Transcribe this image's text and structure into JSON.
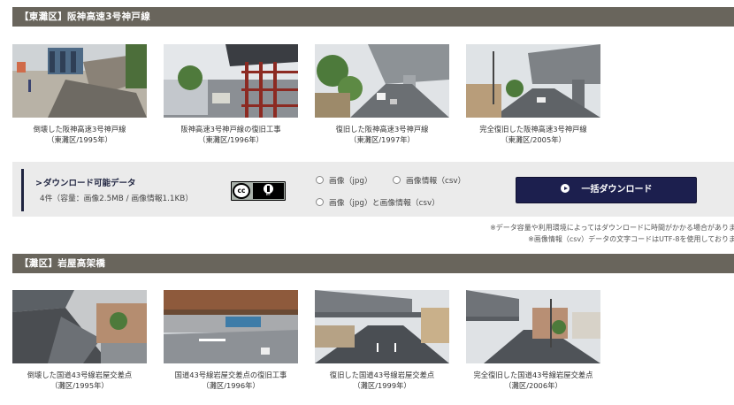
{
  "sections": [
    {
      "title": "【東灘区】阪神高速3号神戸線",
      "photos": [
        {
          "caption": "倒壊した阪神高速3号神戸線",
          "sub": "（東灘区/1995年）"
        },
        {
          "caption": "阪神高速3号神戸線の復旧工事",
          "sub": "（東灘区/1996年）"
        },
        {
          "caption": "復旧した阪神高速3号神戸線",
          "sub": "（東灘区/1997年）"
        },
        {
          "caption": "完全復旧した阪神高速3号神戸線",
          "sub": "（東灘区/2005年）"
        }
      ]
    },
    {
      "title": "【灘区】岩屋高架橋",
      "photos": [
        {
          "caption": "倒壊した国道43号線岩屋交差点",
          "sub": "（灘区/1995年）"
        },
        {
          "caption": "国道43号線岩屋交差点の復旧工事",
          "sub": "（灘区/1996年）"
        },
        {
          "caption": "復旧した国道43号線岩屋交差点",
          "sub": "（灘区/1999年）"
        },
        {
          "caption": "完全復旧した国道43号線岩屋交差点",
          "sub": "（灘区/2006年）"
        }
      ]
    }
  ],
  "download": {
    "title": "ダウンロード可能データ",
    "arrow": ">",
    "info": "4件（容量：画像2.5MB / 画像情報1.1KB）",
    "license": {
      "cc": "cc",
      "by": "BY"
    },
    "options": [
      "画像（jpg）",
      "画像情報（csv）",
      "画像（jpg）と画像情報（csv）"
    ],
    "button_label": "一括ダウンロード"
  },
  "notes": [
    "※データ容量や利用環境によってはダウンロードに時間がかかる場合がありま",
    "※画像情報（csv）データの文字コードはUTF-8を使用しておりま"
  ],
  "colors": {
    "header_bg": "#69655c",
    "button_bg": "#1c1f4e",
    "panel_bg": "#ebebeb"
  }
}
